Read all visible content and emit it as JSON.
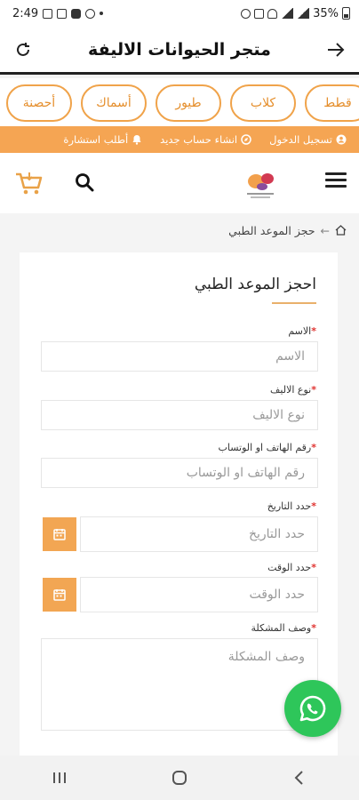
{
  "status_bar": {
    "time": "2:49",
    "battery": "35%"
  },
  "title_bar": {
    "title": "متجر الحيوانات الاليفة"
  },
  "categories": [
    {
      "label": "قطط"
    },
    {
      "label": "كلاب"
    },
    {
      "label": "طيور"
    },
    {
      "label": "أسماك"
    },
    {
      "label": "أحصنة"
    }
  ],
  "top_links": {
    "login": "تسجيل الدخول",
    "register": "انشاء حساب جديد",
    "consult": "أطلب استشارة"
  },
  "breadcrumb": {
    "current": "حجز الموعد الطبي",
    "separator": "←"
  },
  "form": {
    "title": "احجز الموعد الطبي",
    "name_label": "الاسم",
    "name_placeholder": "الاسم",
    "pet_type_label": "نوع الاليف",
    "pet_type_placeholder": "نوع الاليف",
    "phone_label": "رقم الهاتف او الوتساب",
    "phone_placeholder": "رقم الهاتف او الوتساب",
    "date_label": "حدد التاريخ",
    "date_placeholder": "حدد التاريخ",
    "time_label": "حدد الوقت",
    "time_placeholder": "حدد الوقت",
    "problem_label": "وصف المشكلة",
    "problem_placeholder": "وصف المشكلة",
    "required_mark": "*"
  },
  "colors": {
    "accent": "#f5a553",
    "whatsapp": "#2ec65a",
    "required": "#e0322f"
  }
}
